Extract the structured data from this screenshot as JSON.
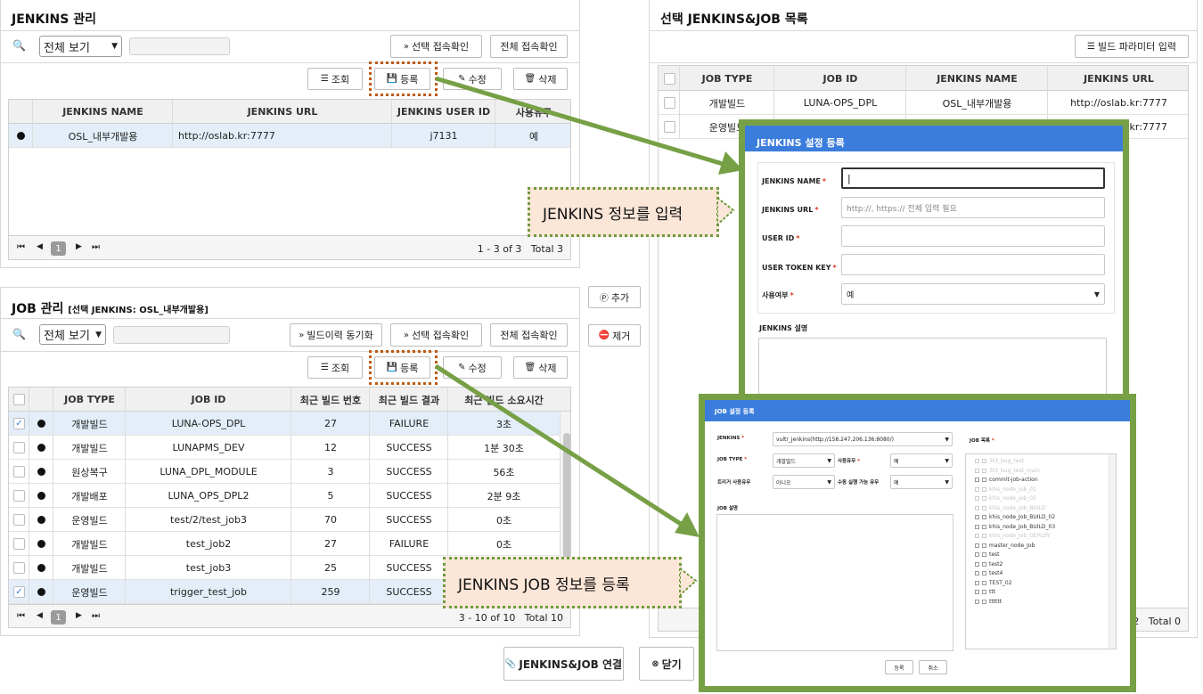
{
  "jenkins_panel": {
    "title": "JENKINS 관리",
    "filter_select": "전체 보기",
    "btn_sel_check": "선택 접속확인",
    "btn_all_check": "전체 접속확인",
    "btn_view": "조회",
    "btn_register": "등록",
    "btn_edit": "수정",
    "btn_delete": "삭제",
    "columns": [
      "JENKINS NAME",
      "JENKINS URL",
      "JENKINS USER ID",
      "사용유무"
    ],
    "rows": [
      {
        "name": "OSL_내부개발용",
        "url": "http://oslab.kr:7777",
        "user_id": "j7131",
        "use": "예"
      }
    ],
    "page": "1",
    "summary": "1 - 3 of 3   Total 3"
  },
  "job_panel": {
    "title": "JOB 관리",
    "subtitle": "[선택 JENKINS: OSL_내부개발용]",
    "filter_select": "전체 보기",
    "btn_sync": "빌드이력 동기화",
    "btn_sel_check": "선택 접속확인",
    "btn_all_check": "전체 접속확인",
    "btn_view": "조회",
    "btn_register": "등록",
    "btn_edit": "수정",
    "btn_delete": "삭제",
    "columns": [
      "JOB TYPE",
      "JOB ID",
      "최근 빌드 번호",
      "최근 빌드 결과",
      "최근 빌드 소요시간"
    ],
    "rows": [
      {
        "checked": true,
        "type": "개발빌드",
        "id": "LUNA-OPS_DPL",
        "num": "27",
        "result": "FAILURE",
        "time": "3초"
      },
      {
        "checked": false,
        "type": "개발빌드",
        "id": "LUNAPMS_DEV",
        "num": "12",
        "result": "SUCCESS",
        "time": "1분 30초"
      },
      {
        "checked": false,
        "type": "원상복구",
        "id": "LUNA_DPL_MODULE",
        "num": "3",
        "result": "SUCCESS",
        "time": "56초"
      },
      {
        "checked": false,
        "type": "개발배포",
        "id": "LUNA_OPS_DPL2",
        "num": "5",
        "result": "SUCCESS",
        "time": "2분 9초"
      },
      {
        "checked": false,
        "type": "운영빌드",
        "id": "test/2/test_job3",
        "num": "70",
        "result": "SUCCESS",
        "time": "0초"
      },
      {
        "checked": false,
        "type": "개발빌드",
        "id": "test_job2",
        "num": "27",
        "result": "FAILURE",
        "time": "0초"
      },
      {
        "checked": false,
        "type": "개발빌드",
        "id": "test_job3",
        "num": "25",
        "result": "SUCCESS",
        "time": ""
      },
      {
        "checked": true,
        "type": "운영빌드",
        "id": "trigger_test_job",
        "num": "259",
        "result": "SUCCESS",
        "time": ""
      }
    ],
    "page": "1",
    "summary": "3 - 10 of 10   Total 10"
  },
  "middle": {
    "btn_add": "추가",
    "btn_remove": "제거"
  },
  "selected_panel": {
    "title": "선택 JENKINS&JOB 목록",
    "btn_param": "빌드 파라미터 입력",
    "columns": [
      "JOB TYPE",
      "JOB ID",
      "JENKINS NAME",
      "JENKINS URL"
    ],
    "rows": [
      {
        "type": "개발빌드",
        "id": "LUNA-OPS_DPL",
        "name": "OSL_내부개발용",
        "url": "http://oslab.kr:7777"
      },
      {
        "type": "운영빌드",
        "id": "",
        "name": "",
        "url": "http://oslab.kr:7777"
      }
    ],
    "summary": "f 2   Total 0"
  },
  "footer": {
    "btn_link": "JENKINS&JOB 연결",
    "btn_close": "닫기"
  },
  "callouts": {
    "jenkins": "JENKINS 정보를 입력",
    "job": "JENKINS JOB 정보를 등록"
  },
  "jenkins_modal": {
    "title": "JENKINS 설정 등록",
    "label_name": "JENKINS NAME",
    "label_url": "JENKINS URL",
    "url_placeholder": "http://, https:// 전체 입력 필요",
    "label_user": "USER ID",
    "label_token": "USER TOKEN KEY",
    "label_use": "사용여부",
    "use_value": "예",
    "label_desc": "JENKINS 설명"
  },
  "job_modal": {
    "title": "JOB 설정 등록",
    "label_jenkins": "JENKINS",
    "jenkins_value": "vultr_jenkins(http://158.247.206.136:8080/)",
    "label_job_list": "JOB 목록",
    "label_type": "JOB TYPE",
    "type_value": "개발빌드",
    "label_use": "사용유무",
    "use_value": "예",
    "label_trigger": "트리거 사용유무",
    "trigger_value": "아니오",
    "label_manual": "수동 실행 가능 유무",
    "manual_value": "예",
    "label_desc": "JOB 설명",
    "btn_save": "등록",
    "btn_cancel": "취소",
    "tree": [
      {
        "label": "3t3_bug_test",
        "dim": true
      },
      {
        "label": "3t3_bug_test_main",
        "dim": true
      },
      {
        "label": "commit-job-action",
        "dim": false
      },
      {
        "label": "khis_node_job_01",
        "dim": true
      },
      {
        "label": "khis_node_job_02",
        "dim": true
      },
      {
        "label": "khis_node_job_BUILD",
        "dim": true
      },
      {
        "label": "khis_node_Job_BUILD_02",
        "dim": false
      },
      {
        "label": "khis_node_Job_BUILD_03",
        "dim": false
      },
      {
        "label": "khis_node_job_DEPLOY",
        "dim": true
      },
      {
        "label": "master_node_Job",
        "dim": false
      },
      {
        "label": "test",
        "dim": false
      },
      {
        "label": "test2",
        "dim": false
      },
      {
        "label": "test4",
        "dim": false
      },
      {
        "label": "TEST_02",
        "dim": false
      },
      {
        "label": "ttt",
        "dim": false
      },
      {
        "label": "tttttt",
        "dim": false
      }
    ]
  },
  "colors": {
    "accent_blue": "#3b7ddc",
    "frame_green": "#77a046",
    "highlight_orange": "#c05a10",
    "callout_bg": "#fbe6d8"
  }
}
